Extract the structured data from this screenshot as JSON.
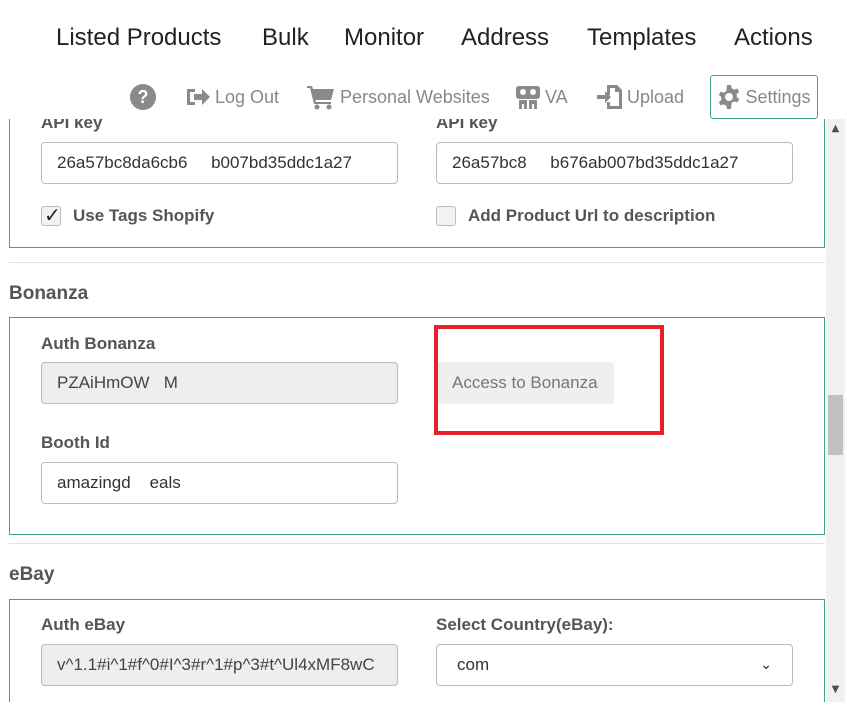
{
  "topnav": {
    "items": [
      "Listed Products",
      "Bulk",
      "Monitor",
      "Address",
      "Templates",
      "Actions"
    ]
  },
  "toolbar": {
    "help_icon": "question-circle-icon",
    "logout_label": "Log Out",
    "personal_websites_label": "Personal Websites",
    "va_label": "VA",
    "upload_label": "Upload",
    "settings_label": "Settings"
  },
  "shopify": {
    "api_key_label_left": "API key",
    "api_key_value_left": "26a57bc8da6cb6     b007bd35ddc1a27",
    "api_key_label_right": "API key",
    "api_key_value_right": "26a57bc8     b676ab007bd35ddc1a27",
    "use_tags_label": "Use Tags Shopify",
    "use_tags_checked": true,
    "add_url_label": "Add Product Url to description",
    "add_url_checked": false
  },
  "bonanza": {
    "section_title": "Bonanza",
    "auth_label": "Auth Bonanza",
    "auth_value": "PZAiHmOW   M",
    "access_button_label": "Access to Bonanza",
    "booth_label": "Booth Id",
    "booth_value": "amazingd    eals"
  },
  "ebay": {
    "section_title": "eBay",
    "auth_label": "Auth eBay",
    "auth_value": "v^1.1#i^1#f^0#I^3#r^1#p^3#t^Ul4xMF8wC",
    "country_label": "Select Country(eBay):",
    "country_value": "com"
  },
  "colors": {
    "panel_border": "#3aa391",
    "highlight": "#e8202a"
  }
}
